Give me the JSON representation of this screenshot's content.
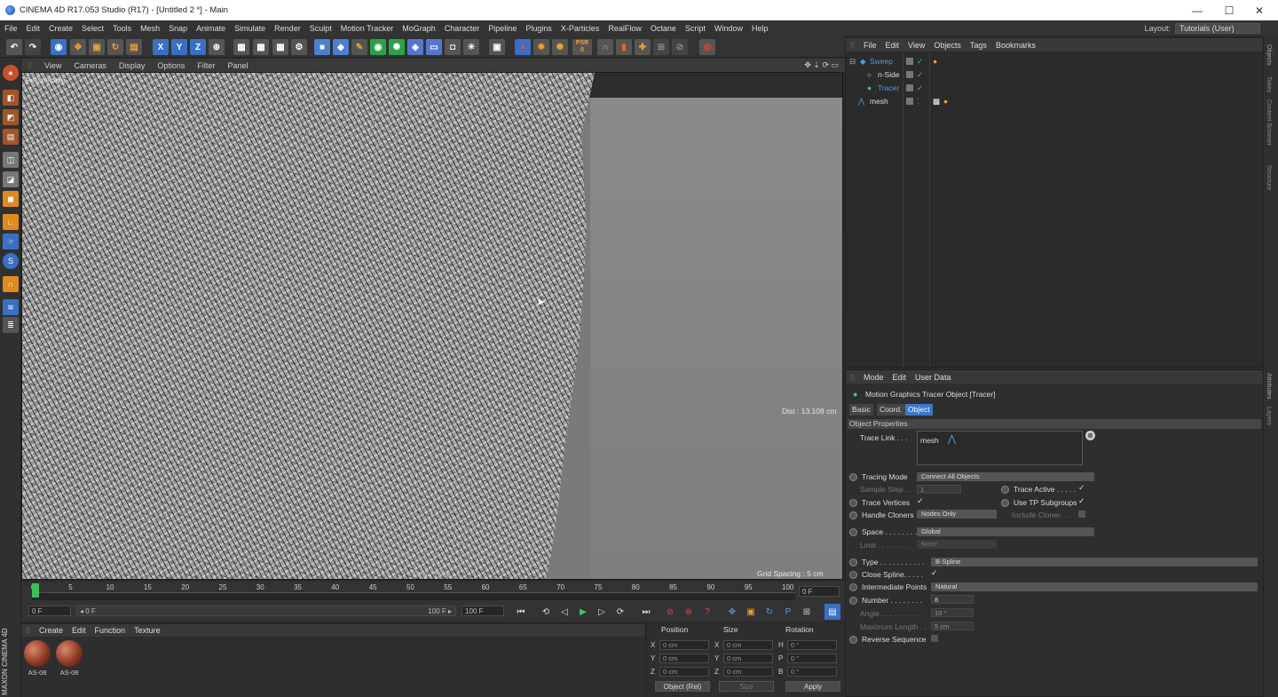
{
  "titlebar": {
    "title": "CINEMA 4D R17.053 Studio (R17) - [Untitled 2 *] - Main",
    "min": "—",
    "max": "☐",
    "close": "✕"
  },
  "menubar": {
    "items": [
      "File",
      "Edit",
      "Create",
      "Select",
      "Tools",
      "Mesh",
      "Snap",
      "Animate",
      "Simulate",
      "Render",
      "Sculpt",
      "Motion Tracker",
      "MoGraph",
      "Character",
      "Pipeline",
      "Plugins",
      "X-Particles",
      "RealFlow",
      "Octane",
      "Script",
      "Window",
      "Help"
    ],
    "layout_label": "Layout:",
    "layout_value": "Tutorials (User)"
  },
  "toolbar": {
    "x": "X",
    "y": "Y",
    "z": "Z",
    "psr": "PSR",
    "psr_value": "0"
  },
  "viewport": {
    "menu": [
      "View",
      "Cameras",
      "Display",
      "Options",
      "Filter",
      "Panel"
    ],
    "label": "Perspective",
    "dist": "Dist : 13.108 cm",
    "grid": "Grid Spacing : 5 cm",
    "fps": "FPS : 15.3"
  },
  "timeline": {
    "ticks": [
      "0",
      "5",
      "10",
      "15",
      "20",
      "25",
      "30",
      "35",
      "40",
      "45",
      "50",
      "55",
      "60",
      "65",
      "70",
      "75",
      "80",
      "85",
      "90",
      "95",
      "100"
    ],
    "frame_field": "0 F"
  },
  "playback": {
    "start": "0 F",
    "current": "◂ 0 F",
    "end_inner": "100 F ▸",
    "end": "100 F"
  },
  "materials": {
    "menu": [
      "Create",
      "Edit",
      "Function",
      "Texture"
    ],
    "items": [
      {
        "name": "AS-08"
      },
      {
        "name": "AS-08"
      }
    ]
  },
  "coords": {
    "headers": [
      "Position",
      "Size",
      "Rotation"
    ],
    "rows": [
      {
        "a": "X",
        "av": "0 cm",
        "b": "X",
        "bv": "0 cm",
        "c": "H",
        "cv": "0 °"
      },
      {
        "a": "Y",
        "av": "0 cm",
        "b": "Y",
        "bv": "0 cm",
        "c": "P",
        "cv": "0 °"
      },
      {
        "a": "Z",
        "av": "0 cm",
        "b": "Z",
        "bv": "0 cm",
        "c": "B",
        "cv": "0 °"
      }
    ],
    "mode": "Object (Rel)",
    "size_mode": "Size",
    "apply": "Apply"
  },
  "objects": {
    "menu": [
      "File",
      "Edit",
      "View",
      "Objects",
      "Tags",
      "Bookmarks"
    ],
    "items": [
      {
        "name": "Sweep",
        "color": "#4b9be8"
      },
      {
        "name": "n-Side",
        "color": "#dddddd"
      },
      {
        "name": "Tracer",
        "color": "#4b9be8"
      },
      {
        "name": "mesh",
        "color": "#dddddd"
      }
    ]
  },
  "attributes": {
    "menu": [
      "Mode",
      "Edit",
      "User Data"
    ],
    "title": "Motion Graphics Tracer Object [Tracer]",
    "tabs": [
      "Basic",
      "Coord.",
      "Object"
    ],
    "section": "Object Properties",
    "trace_link_label": "Trace Link . . .",
    "trace_link_value": "mesh",
    "tracing_mode_label": "Tracing Mode",
    "tracing_mode_value": "Connect All Objects",
    "sample_step_label": "Sample Step . . .",
    "sample_step_value": "1",
    "trace_active_label": "Trace Active . . . . .",
    "trace_vertices_label": "Trace Vertices",
    "use_tp_label": "Use TP Subgroups",
    "handle_cloners_label": "Handle Cloners",
    "handle_cloners_value": "Nodes Only",
    "include_cloner_label": "Include Cloner. . .",
    "space_label": "Space . . . . . . . .",
    "space_value": "Global",
    "limit_label": "Limit . . . . . . . .",
    "limit_value": "None",
    "type_label": "Type . . . . . . . . . . .",
    "type_value": "B-Spline",
    "close_spline_label": "Close Spline. . . . .",
    "intermediate_label": "Intermediate Points",
    "intermediate_value": "Natural",
    "number_label": "Number . . . . . . . .",
    "number_value": "8",
    "angle_label": "Angle . . . . . . . . . .",
    "angle_value": "10 °",
    "maxlen_label": "Maximum Length . .",
    "maxlen_value": "5 cm",
    "reverse_label": "Reverse Sequence",
    "check": "✓"
  },
  "rightstrip": {
    "tabs": [
      "Objects",
      "Takes",
      "Content Browser",
      "Structure",
      "Attributes",
      "Layers"
    ]
  },
  "brand": "MAXON CINEMA 4D"
}
